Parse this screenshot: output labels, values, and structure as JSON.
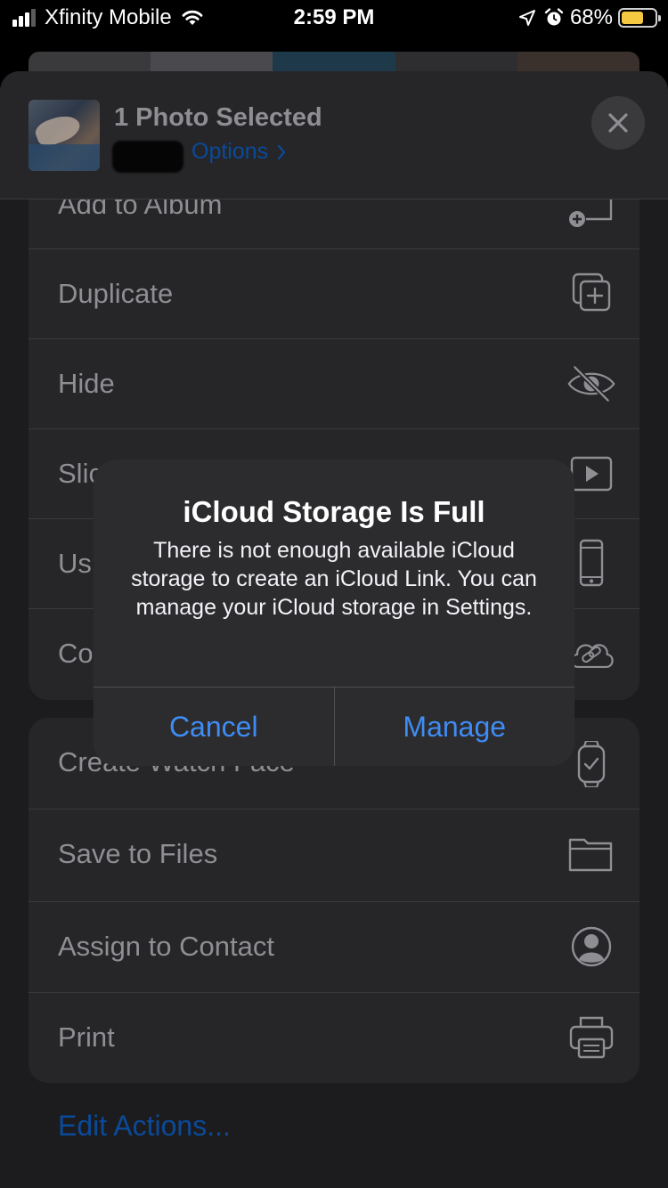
{
  "status_bar": {
    "carrier": "Xfinity Mobile",
    "time": "2:59 PM",
    "battery_percent": "68%",
    "battery_level": 0.68,
    "battery_color": "#f5c842",
    "icons": [
      "signal-bars-icon",
      "wifi-icon",
      "location-arrow-icon",
      "alarm-icon",
      "battery-icon"
    ]
  },
  "share_sheet": {
    "title": "1 Photo Selected",
    "options_label": "Options",
    "close_icon": "close-icon"
  },
  "action_group_1": [
    {
      "label": "Add to Album",
      "icon": "add-to-album-icon"
    },
    {
      "label": "Duplicate",
      "icon": "duplicate-icon"
    },
    {
      "label": "Hide",
      "icon": "eye-slash-icon"
    },
    {
      "label": "Slic",
      "icon": "play-icon"
    },
    {
      "label": "Us",
      "icon": "iphone-icon"
    },
    {
      "label": "Co",
      "icon": "icloud-link-icon"
    }
  ],
  "action_group_2": [
    {
      "label": "Create Watch Face",
      "icon": "watch-icon"
    },
    {
      "label": "Save to Files",
      "icon": "folder-icon"
    },
    {
      "label": "Assign to Contact",
      "icon": "contact-icon"
    },
    {
      "label": "Print",
      "icon": "printer-icon"
    }
  ],
  "edit_actions_label": "Edit Actions...",
  "alert": {
    "title": "iCloud Storage Is Full",
    "message": "There is not enough available iCloud storage to create an iCloud Link. You can manage your iCloud storage in Settings.",
    "cancel_label": "Cancel",
    "manage_label": "Manage"
  },
  "colors": {
    "accent_blue": "#3f8cf5",
    "dim_blue": "#0a4a9a",
    "sheet_background": "#1c1c1e",
    "row_background": "#262628"
  }
}
